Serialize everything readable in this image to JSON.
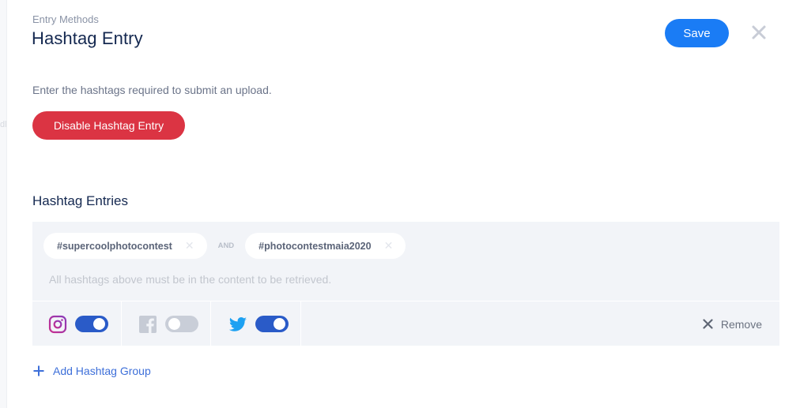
{
  "sidebar_ghost_text": "dl",
  "header": {
    "breadcrumb": "Entry Methods",
    "title": "Hashtag Entry",
    "save_label": "Save",
    "close_icon": "close-icon"
  },
  "description": "Enter the hashtags required to submit an upload.",
  "disable_button_label": "Disable Hashtag Entry",
  "section_title": "Hashtag Entries",
  "colors": {
    "save": "#1a7cf5",
    "disable": "#db3443",
    "toggle_on": "#2a5bc8",
    "toggle_off": "#c9ced8",
    "link": "#3d6fd9"
  },
  "hashtag_groups": [
    {
      "tags": [
        "#supercoolphotocontest",
        "#photocontestmaia2020"
      ],
      "connector": "AND",
      "hint": "All hashtags above must be in the content to be retrieved.",
      "networks": [
        {
          "name": "Instagram",
          "icon": "instagram-icon",
          "enabled": true
        },
        {
          "name": "Facebook",
          "icon": "facebook-icon",
          "enabled": false
        },
        {
          "name": "Twitter",
          "icon": "twitter-icon",
          "enabled": true
        }
      ],
      "remove_label": "Remove"
    }
  ],
  "add_group_label": "Add Hashtag Group"
}
